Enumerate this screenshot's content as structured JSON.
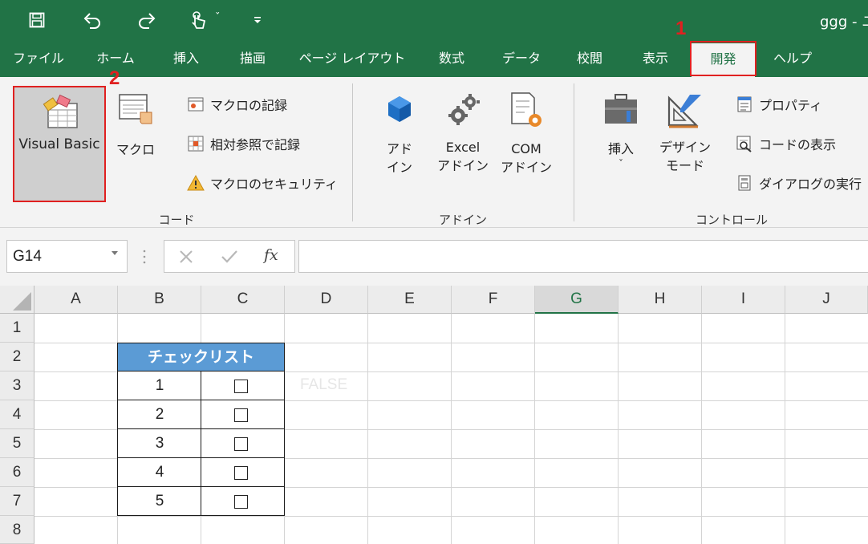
{
  "colors": {
    "excel_green": "#217346",
    "ribbon_bg": "#f3f3f3",
    "highlight_red": "#e02020",
    "table_header_blue": "#5b9bd5"
  },
  "title_bar": {
    "doc_title": "ggg - ユ"
  },
  "quick_access": {
    "icons": [
      "save-icon",
      "undo-icon",
      "redo-icon",
      "touch-mode-icon",
      "customize-toolbar-icon"
    ],
    "touch_dropdown": "ˇ"
  },
  "tabs": [
    {
      "label": "ファイル"
    },
    {
      "label": "ホーム"
    },
    {
      "label": "挿入"
    },
    {
      "label": "描画"
    },
    {
      "label": "ページ レイアウト"
    },
    {
      "label": "数式"
    },
    {
      "label": "データ"
    },
    {
      "label": "校閲"
    },
    {
      "label": "表示"
    },
    {
      "label": "開発"
    },
    {
      "label": "ヘルプ"
    }
  ],
  "active_tab": "開発",
  "annotations": {
    "step1": "1",
    "step2": "2"
  },
  "ribbon": {
    "code_group": {
      "label": "コード",
      "visual_basic": "Visual Basic",
      "macro": "マクロ",
      "record_macro": "マクロの記録",
      "relative_ref": "相対参照で記録",
      "macro_security": "マクロのセキュリティ"
    },
    "addin_group": {
      "label": "アドイン",
      "addins_line1": "アド",
      "addins_line2": "イン",
      "excel_addins_line1": "Excel",
      "excel_addins_line2": "アドイン",
      "com_addins_line1": "COM",
      "com_addins_line2": "アドイン"
    },
    "control_group": {
      "label": "コントロール",
      "insert": "挿入",
      "insert_dropdown": "ˇ",
      "design_mode_line1": "デザイン",
      "design_mode_line2": "モード",
      "properties": "プロパティ",
      "view_code": "コードの表示",
      "run_dialog": "ダイアログの実行"
    }
  },
  "formula_bar": {
    "name_box": "G14",
    "fx": "fx",
    "formula": ""
  },
  "columns": [
    "A",
    "B",
    "C",
    "D",
    "E",
    "F",
    "G",
    "H",
    "I",
    "J"
  ],
  "selected_column": "G",
  "rows": [
    "1",
    "2",
    "3",
    "4",
    "5",
    "6",
    "7",
    "8"
  ],
  "sheet": {
    "checklist_header": "チェックリスト",
    "items": [
      "1",
      "2",
      "3",
      "4",
      "5"
    ],
    "d3_faint_text": "FALSE"
  }
}
